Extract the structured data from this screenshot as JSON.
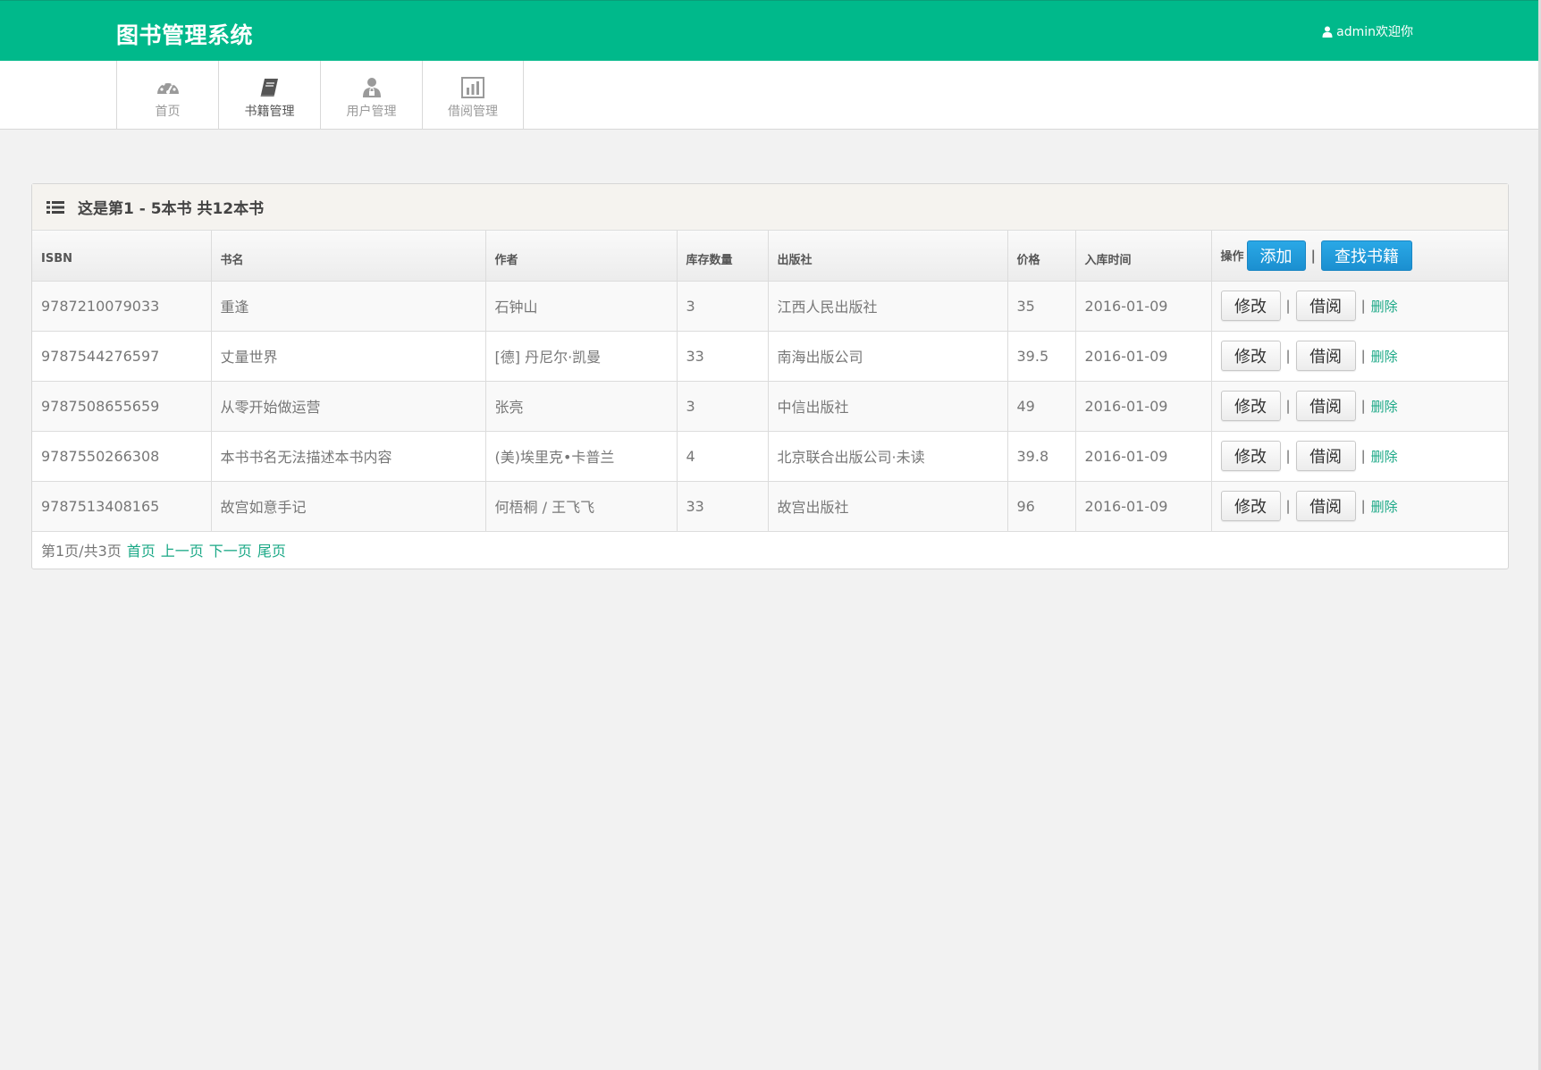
{
  "header": {
    "brand": "图书管理系统",
    "user_text": "admin欢迎你"
  },
  "nav": [
    {
      "label": "首页",
      "icon": "dashboard-icon"
    },
    {
      "label": "书籍管理",
      "icon": "book-icon",
      "active": true
    },
    {
      "label": "用户管理",
      "icon": "user-manage-icon"
    },
    {
      "label": "借阅管理",
      "icon": "bar-chart-icon"
    }
  ],
  "panel": {
    "title": "这是第1 - 5本书 共12本书"
  },
  "table": {
    "headers": [
      "ISBN",
      "书名",
      "作者",
      "库存数量",
      "出版社",
      "价格",
      "入库时间",
      "操作"
    ],
    "add_label": "添加",
    "search_label": "查找书籍",
    "edit_label": "修改",
    "borrow_label": "借阅",
    "delete_label": "删除",
    "separator": "|",
    "rows": [
      {
        "isbn": "9787210079033",
        "title": "重逢",
        "author": "石钟山",
        "stock": "3",
        "publisher": "江西人民出版社",
        "price": "35",
        "date": "2016-01-09"
      },
      {
        "isbn": "9787544276597",
        "title": "丈量世界",
        "author": "[德] 丹尼尔·凯曼",
        "stock": "33",
        "publisher": "南海出版公司",
        "price": "39.5",
        "date": "2016-01-09"
      },
      {
        "isbn": "9787508655659",
        "title": "从零开始做运营",
        "author": "张亮",
        "stock": "3",
        "publisher": "中信出版社",
        "price": "49",
        "date": "2016-01-09"
      },
      {
        "isbn": "9787550266308",
        "title": "本书书名无法描述本书内容",
        "author": "(美)埃里克•卡普兰",
        "stock": "4",
        "publisher": "北京联合出版公司·未读",
        "price": "39.8",
        "date": "2016-01-09"
      },
      {
        "isbn": "9787513408165",
        "title": "故宫如意手记",
        "author": "何梧桐 / 王飞飞",
        "stock": "33",
        "publisher": "故宫出版社",
        "price": "96",
        "date": "2016-01-09"
      }
    ]
  },
  "pager": {
    "info": "第1页/共3页",
    "first": "首页",
    "prev": "上一页",
    "next": "下一页",
    "last": "尾页"
  },
  "colors": {
    "header_bg": "#00b98b",
    "primary_button": "#1b8fd0",
    "link": "#1aa886"
  }
}
